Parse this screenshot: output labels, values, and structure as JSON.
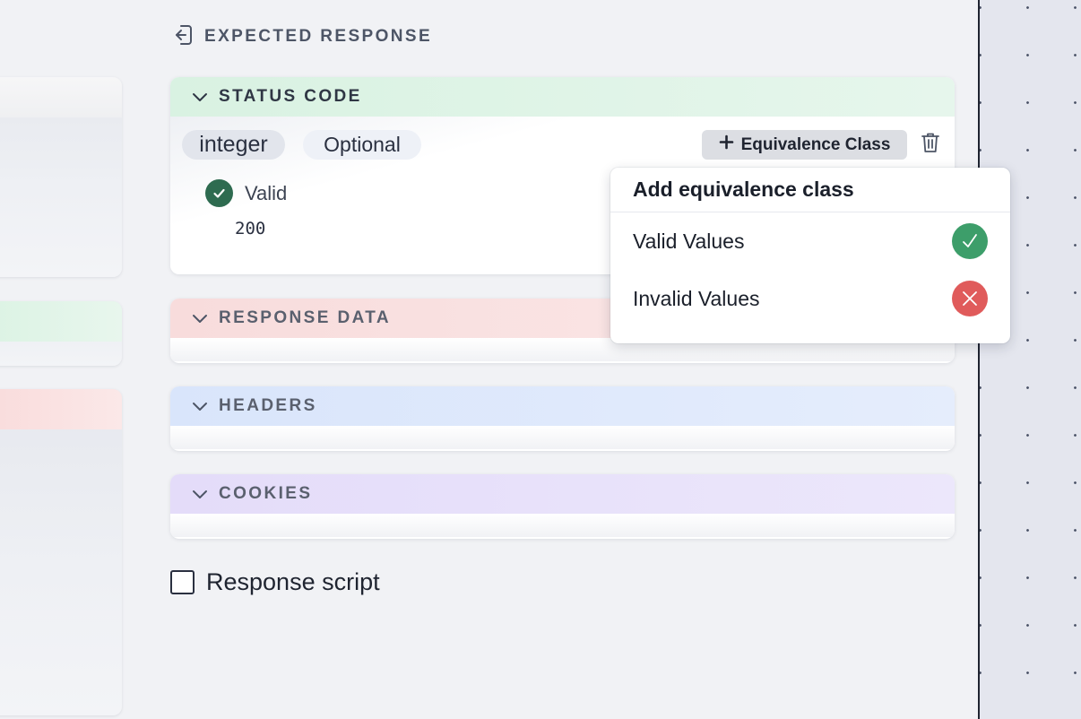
{
  "expected_response": {
    "title": "EXPECTED RESPONSE",
    "icon": "sign-in-icon"
  },
  "status_code": {
    "title": "STATUS CODE",
    "type": "integer",
    "optional_label": "Optional",
    "add_button_label": "Equivalence Class",
    "valid_label": "Valid",
    "valid_value": "200",
    "header_color": "#d9f2e2"
  },
  "popup": {
    "title": "Add equivalence class",
    "items": [
      {
        "label": "Valid Values",
        "icon": "check-circle-icon",
        "color": "#3d9e6a"
      },
      {
        "label": "Invalid Values",
        "icon": "x-circle-icon",
        "color": "#e05b5b"
      }
    ]
  },
  "sections": [
    {
      "title": "RESPONSE DATA",
      "color": "#f8dcdc"
    },
    {
      "title": "HEADERS",
      "color": "#d9e5fb"
    },
    {
      "title": "COOKIES",
      "color": "#e4dcf9"
    }
  ],
  "response_script": {
    "label": "Response script",
    "checked": false
  }
}
